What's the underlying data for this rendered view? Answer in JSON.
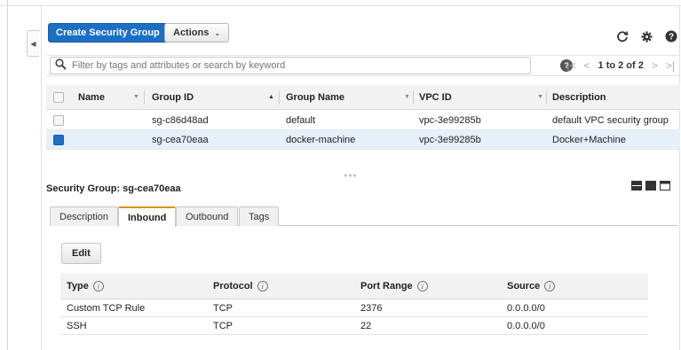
{
  "toolbar": {
    "create_label": "Create Security Group",
    "actions_label": "Actions"
  },
  "icons": {
    "refresh": "refresh-icon",
    "settings": "gear-icon",
    "help": "help-icon"
  },
  "filter": {
    "placeholder": "Filter by tags and attributes or search by keyword",
    "help_glyph": "?",
    "pager": "1 to 2 of 2"
  },
  "grid": {
    "columns": [
      "Name",
      "Group ID",
      "Group Name",
      "VPC ID",
      "Description"
    ],
    "rows": [
      {
        "name": "",
        "group_id": "sg-c86d48ad",
        "group_name": "default",
        "vpc_id": "vpc-3e99285b",
        "description": "default VPC security group",
        "selected": false
      },
      {
        "name": "",
        "group_id": "sg-cea70eaa",
        "group_name": "docker-machine",
        "vpc_id": "vpc-3e99285b",
        "description": "Docker+Machine",
        "selected": true
      }
    ]
  },
  "detail": {
    "title": "Security Group: sg-cea70eaa",
    "tabs": [
      "Description",
      "Inbound",
      "Outbound",
      "Tags"
    ],
    "active_tab": "Inbound",
    "edit_label": "Edit",
    "rule_columns": [
      "Type",
      "Protocol",
      "Port Range",
      "Source"
    ],
    "rules": [
      {
        "type": "Custom TCP Rule",
        "protocol": "TCP",
        "port_range": "2376",
        "source": "0.0.0.0/0"
      },
      {
        "type": "SSH",
        "protocol": "TCP",
        "port_range": "22",
        "source": "0.0.0.0/0"
      }
    ]
  },
  "colors": {
    "primary": "#1c6fc5",
    "active_tab_accent": "#e08e0b",
    "selected_row": "#e6f0fb"
  }
}
